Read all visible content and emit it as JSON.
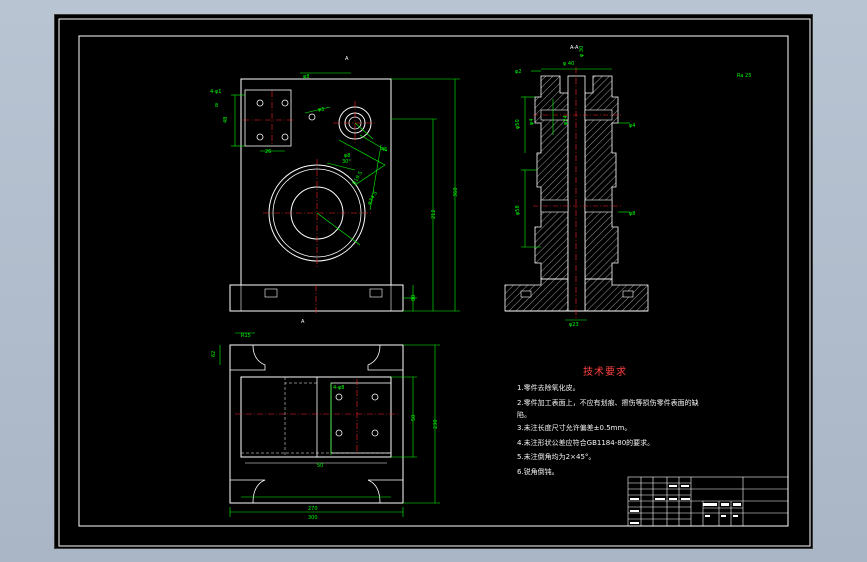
{
  "tech_requirements": {
    "title": "技术要求",
    "items": [
      "1.零件去除氧化皮。",
      "2.零件加工表面上，不应有划痕、擦伤等损伤零件表面的缺",
      "陷。",
      "3.未注长度尺寸允许偏差±0.5mm。",
      "4.未注形状公差应符合GB1184-80的要求。",
      "5.未注倒角均为2×45°。",
      "6.锐角倒钝。"
    ]
  },
  "colors": {
    "outline": "#ffffff",
    "dimension": "#00ff00",
    "centerline": "#ff2020",
    "hatch": "#ffffff",
    "annotation": "#00ffff",
    "border": "#ffffff"
  },
  "dimensions": {
    "front_height": "360",
    "front_width": "212",
    "section_height": "80",
    "top_width_overall": "300",
    "top_width_inner": "270",
    "top_depth": "230",
    "top_depth_inner": "50",
    "top_side": "62",
    "roughness": "Ra 25"
  }
}
